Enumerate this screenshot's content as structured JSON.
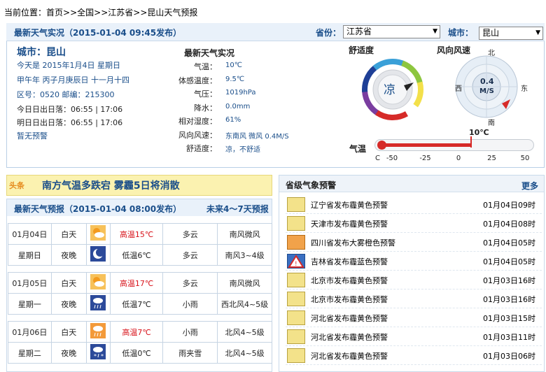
{
  "breadcrumb": {
    "prefix": "当前位置：",
    "home": "首页",
    "sep1": ">>",
    "nation": "全国",
    "sep2": ">>",
    "province": "江苏省",
    "sep3": ">>",
    "current": "昆山天气预报"
  },
  "header": {
    "title": "最新天气实况（2015-01-04 09:45发布）",
    "province_label": "省份：",
    "province_value": "江苏省",
    "city_label": "城市：",
    "city_value": "昆山"
  },
  "city_info": {
    "city": "城市：昆山",
    "today": "今天是 2015年1月4日 星期日",
    "lunar": "甲午年 丙子月庚辰日 十一月十四",
    "codes": "区号：0520  邮编：215300",
    "today_sun": "今日日出日落：06:55 | 17:06",
    "tomorrow_sun": "明日日出日落：06:55 | 17:06",
    "warning": "暂无预警"
  },
  "realtime": {
    "title": "最新天气实况",
    "rows": [
      {
        "label": "气温：",
        "value": "10℃"
      },
      {
        "label": "体感温度：",
        "value": "9.5℃"
      },
      {
        "label": "气压：",
        "value": "1019hPa"
      },
      {
        "label": "降水：",
        "value": "0.0mm"
      },
      {
        "label": "相对湿度：",
        "value": "61%"
      },
      {
        "label": "风向风速：",
        "value": "东南风 微风 0.4M/S"
      },
      {
        "label": "舒适度：",
        "value": "凉，不舒适"
      }
    ]
  },
  "comfort": {
    "title": "舒适度",
    "value": "凉"
  },
  "wind": {
    "title": "风向风速",
    "speed": "0.4",
    "unit": "M/S",
    "north": "北",
    "south": "南",
    "east": "东",
    "west": "西"
  },
  "thermo": {
    "label": "气温",
    "value_text": "10℃",
    "value": 10,
    "min": -50,
    "max": 50,
    "unit_label": "C",
    "ticks": [
      "-50",
      "-25",
      "0",
      "25",
      "50"
    ]
  },
  "headline": {
    "tag": "头条",
    "text": "南方气温多跌宕  雾霾5日将消散"
  },
  "forecast": {
    "title": "最新天气预报（2015-01-04 08:00发布）",
    "link": "未来4～7天预报",
    "days": [
      {
        "date": "01月04日",
        "weekday": "星期日",
        "day_label": "白天",
        "night_label": "夜晚",
        "high": "高温15℃",
        "low": "低温6℃",
        "day_weather": "多云",
        "night_weather": "多云",
        "day_wind": "南风微风",
        "night_wind": "南风3~4级",
        "day_icon": "sunny-cloudy-icon",
        "night_icon": "moon-icon"
      },
      {
        "date": "01月05日",
        "weekday": "星期一",
        "day_label": "白天",
        "night_label": "夜晚",
        "high": "高温17℃",
        "low": "低温7℃",
        "day_weather": "多云",
        "night_weather": "小雨",
        "day_wind": "南风微风",
        "night_wind": "西北风4~5级",
        "day_icon": "sunny-cloudy-icon",
        "night_icon": "rain-icon"
      },
      {
        "date": "01月06日",
        "weekday": "星期二",
        "day_label": "白天",
        "night_label": "夜晚",
        "high": "高温7℃",
        "low": "低温0℃",
        "day_weather": "小雨",
        "night_weather": "雨夹雪",
        "day_wind": "北风4~5级",
        "night_wind": "北风4~5级",
        "day_icon": "rain-icon",
        "night_icon": "sleet-icon"
      }
    ]
  },
  "warnings": {
    "title": "省级气象预警",
    "more": "更多",
    "items": [
      {
        "text": "辽宁省发布霾黄色预警",
        "time": "01月04日09时",
        "icon": "haze-yellow-icon"
      },
      {
        "text": "天津市发布霾黄色预警",
        "time": "01月04日08时",
        "icon": "haze-yellow-icon"
      },
      {
        "text": "四川省发布大雾橙色预警",
        "time": "01月04日05时",
        "icon": "fog-orange-icon"
      },
      {
        "text": "吉林省发布霾蓝色预警",
        "time": "01月04日05时",
        "icon": "warning-triangle-icon"
      },
      {
        "text": "北京市发布霾黄色预警",
        "time": "01月03日16时",
        "icon": "haze-yellow-icon"
      },
      {
        "text": "北京市发布霾黄色预警",
        "time": "01月03日16时",
        "icon": "haze-yellow-icon"
      },
      {
        "text": "河北省发布霾黄色预警",
        "time": "01月03日15时",
        "icon": "haze-yellow-icon"
      },
      {
        "text": "河北省发布霾黄色预警",
        "time": "01月03日11时",
        "icon": "haze-yellow-icon"
      },
      {
        "text": "河北省发布霾黄色预警",
        "time": "01月03日06时",
        "icon": "haze-yellow-icon"
      }
    ]
  },
  "colors": {
    "accent": "#1a4e8a",
    "high_temp": "#d8141c",
    "headline_bg": "#fbf2b0"
  }
}
